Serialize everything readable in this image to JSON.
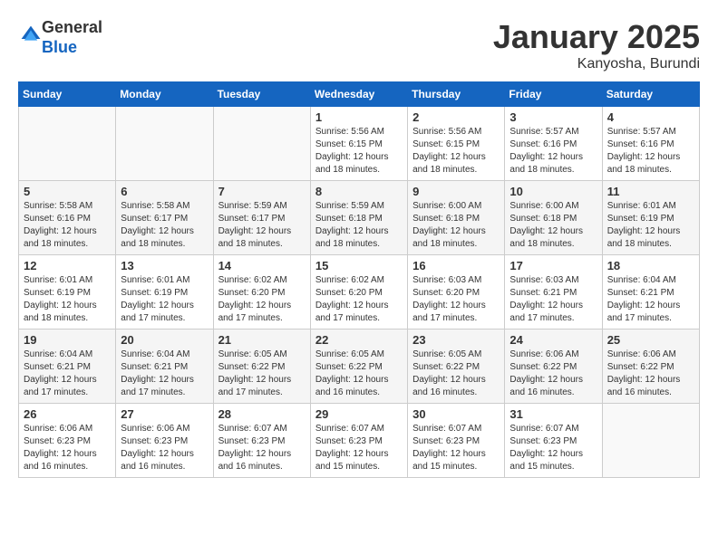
{
  "header": {
    "logo_general": "General",
    "logo_blue": "Blue",
    "month_title": "January 2025",
    "location": "Kanyosha, Burundi"
  },
  "calendar": {
    "weekdays": [
      "Sunday",
      "Monday",
      "Tuesday",
      "Wednesday",
      "Thursday",
      "Friday",
      "Saturday"
    ],
    "weeks": [
      [
        {
          "day": "",
          "empty": true
        },
        {
          "day": "",
          "empty": true
        },
        {
          "day": "",
          "empty": true
        },
        {
          "day": "1",
          "sunrise": "5:56 AM",
          "sunset": "6:15 PM",
          "daylight": "12 hours and 18 minutes."
        },
        {
          "day": "2",
          "sunrise": "5:56 AM",
          "sunset": "6:15 PM",
          "daylight": "12 hours and 18 minutes."
        },
        {
          "day": "3",
          "sunrise": "5:57 AM",
          "sunset": "6:16 PM",
          "daylight": "12 hours and 18 minutes."
        },
        {
          "day": "4",
          "sunrise": "5:57 AM",
          "sunset": "6:16 PM",
          "daylight": "12 hours and 18 minutes."
        }
      ],
      [
        {
          "day": "5",
          "sunrise": "5:58 AM",
          "sunset": "6:16 PM",
          "daylight": "12 hours and 18 minutes."
        },
        {
          "day": "6",
          "sunrise": "5:58 AM",
          "sunset": "6:17 PM",
          "daylight": "12 hours and 18 minutes."
        },
        {
          "day": "7",
          "sunrise": "5:59 AM",
          "sunset": "6:17 PM",
          "daylight": "12 hours and 18 minutes."
        },
        {
          "day": "8",
          "sunrise": "5:59 AM",
          "sunset": "6:18 PM",
          "daylight": "12 hours and 18 minutes."
        },
        {
          "day": "9",
          "sunrise": "6:00 AM",
          "sunset": "6:18 PM",
          "daylight": "12 hours and 18 minutes."
        },
        {
          "day": "10",
          "sunrise": "6:00 AM",
          "sunset": "6:18 PM",
          "daylight": "12 hours and 18 minutes."
        },
        {
          "day": "11",
          "sunrise": "6:01 AM",
          "sunset": "6:19 PM",
          "daylight": "12 hours and 18 minutes."
        }
      ],
      [
        {
          "day": "12",
          "sunrise": "6:01 AM",
          "sunset": "6:19 PM",
          "daylight": "12 hours and 18 minutes."
        },
        {
          "day": "13",
          "sunrise": "6:01 AM",
          "sunset": "6:19 PM",
          "daylight": "12 hours and 17 minutes."
        },
        {
          "day": "14",
          "sunrise": "6:02 AM",
          "sunset": "6:20 PM",
          "daylight": "12 hours and 17 minutes."
        },
        {
          "day": "15",
          "sunrise": "6:02 AM",
          "sunset": "6:20 PM",
          "daylight": "12 hours and 17 minutes."
        },
        {
          "day": "16",
          "sunrise": "6:03 AM",
          "sunset": "6:20 PM",
          "daylight": "12 hours and 17 minutes."
        },
        {
          "day": "17",
          "sunrise": "6:03 AM",
          "sunset": "6:21 PM",
          "daylight": "12 hours and 17 minutes."
        },
        {
          "day": "18",
          "sunrise": "6:04 AM",
          "sunset": "6:21 PM",
          "daylight": "12 hours and 17 minutes."
        }
      ],
      [
        {
          "day": "19",
          "sunrise": "6:04 AM",
          "sunset": "6:21 PM",
          "daylight": "12 hours and 17 minutes."
        },
        {
          "day": "20",
          "sunrise": "6:04 AM",
          "sunset": "6:21 PM",
          "daylight": "12 hours and 17 minutes."
        },
        {
          "day": "21",
          "sunrise": "6:05 AM",
          "sunset": "6:22 PM",
          "daylight": "12 hours and 17 minutes."
        },
        {
          "day": "22",
          "sunrise": "6:05 AM",
          "sunset": "6:22 PM",
          "daylight": "12 hours and 16 minutes."
        },
        {
          "day": "23",
          "sunrise": "6:05 AM",
          "sunset": "6:22 PM",
          "daylight": "12 hours and 16 minutes."
        },
        {
          "day": "24",
          "sunrise": "6:06 AM",
          "sunset": "6:22 PM",
          "daylight": "12 hours and 16 minutes."
        },
        {
          "day": "25",
          "sunrise": "6:06 AM",
          "sunset": "6:22 PM",
          "daylight": "12 hours and 16 minutes."
        }
      ],
      [
        {
          "day": "26",
          "sunrise": "6:06 AM",
          "sunset": "6:23 PM",
          "daylight": "12 hours and 16 minutes."
        },
        {
          "day": "27",
          "sunrise": "6:06 AM",
          "sunset": "6:23 PM",
          "daylight": "12 hours and 16 minutes."
        },
        {
          "day": "28",
          "sunrise": "6:07 AM",
          "sunset": "6:23 PM",
          "daylight": "12 hours and 16 minutes."
        },
        {
          "day": "29",
          "sunrise": "6:07 AM",
          "sunset": "6:23 PM",
          "daylight": "12 hours and 15 minutes."
        },
        {
          "day": "30",
          "sunrise": "6:07 AM",
          "sunset": "6:23 PM",
          "daylight": "12 hours and 15 minutes."
        },
        {
          "day": "31",
          "sunrise": "6:07 AM",
          "sunset": "6:23 PM",
          "daylight": "12 hours and 15 minutes."
        },
        {
          "day": "",
          "empty": true
        }
      ]
    ],
    "labels": {
      "sunrise": "Sunrise:",
      "sunset": "Sunset:",
      "daylight": "Daylight:"
    }
  }
}
